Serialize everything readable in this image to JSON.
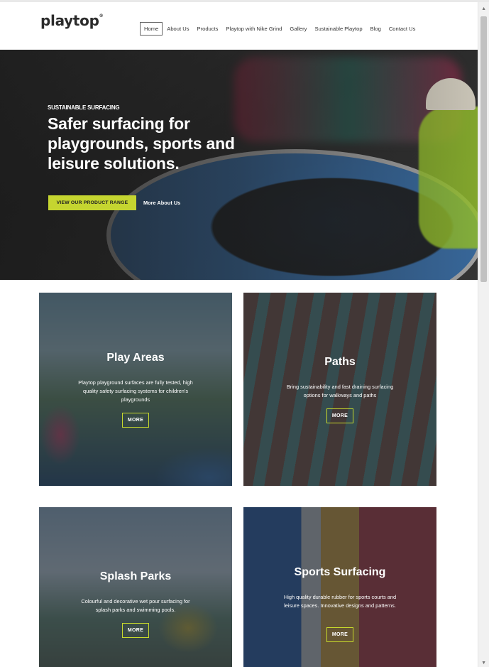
{
  "site": {
    "logo_text": "playtop",
    "logo_mark": "®"
  },
  "nav": {
    "items": [
      {
        "label": "Home",
        "active": true
      },
      {
        "label": "About Us"
      },
      {
        "label": "Products"
      },
      {
        "label": "Playtop with Nike Grind"
      },
      {
        "label": "Gallery"
      },
      {
        "label": "Sustainable Playtop"
      },
      {
        "label": "Blog"
      },
      {
        "label": "Contact Us"
      }
    ]
  },
  "hero": {
    "eyebrow": "SUSTAINABLE SURFACING",
    "title": "Safer surfacing for playgrounds, sports and leisure solutions.",
    "cta_label": "VIEW OUR PRODUCT RANGE",
    "link_label": "More About Us"
  },
  "cards": [
    {
      "title": "Play Areas",
      "description": "Playtop playground surfaces are fully tested, high quality safety surfacing systems for children's playgrounds",
      "button": "MORE"
    },
    {
      "title": "Paths",
      "description": "Bring sustainability and fast draining surfacing options for walkways and paths",
      "button": "MORE"
    },
    {
      "title": "Splash Parks",
      "description": "Colourful and decorative wet pour surfacing for splash parks and swimming pools.",
      "button": "MORE"
    },
    {
      "title": "Sports Surfacing",
      "description": "High quality durable rubber for sports courts and leisure spaces. Innovative designs and patterns.",
      "button": "MORE"
    }
  ],
  "colors": {
    "accent": "#c5d530",
    "overlay": "#1e2630"
  },
  "icons": {
    "scroll_up": "arrow-up-icon",
    "scroll_down": "arrow-down-icon"
  }
}
